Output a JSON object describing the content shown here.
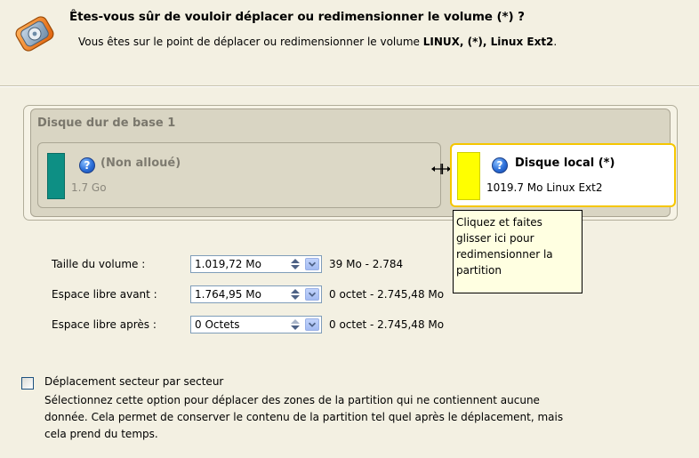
{
  "header": {
    "title": "Êtes-vous sûr de vouloir déplacer ou redimensionner le volume (*) ?",
    "subtitle_prefix": "Vous êtes sur le point de déplacer ou redimensionner le volume ",
    "subtitle_bold": "LINUX, (*), Linux Ext2",
    "subtitle_suffix": ".",
    "icon": "partition-resize-icon"
  },
  "disk": {
    "title": "Disque dur de base 1",
    "partitions": [
      {
        "name": "(Non alloué)",
        "detail": "1.7 Go",
        "color": "#0d8f84",
        "icon": "help-icon"
      },
      {
        "name": "Disque local (*)",
        "detail": "1019.7 Mo Linux Ext2",
        "color": "#ffff00",
        "icon": "help-icon"
      }
    ]
  },
  "tooltip": {
    "lines": [
      "Cliquez et faites",
      "glisser ici pour",
      "redimensionner la",
      "partition"
    ]
  },
  "fields": [
    {
      "label": "Taille du volume :",
      "value": "1.019,72 Mo",
      "range": "39 Mo - 2.784"
    },
    {
      "label": "Espace libre avant :",
      "value": "1.764,95 Mo",
      "range": "0 octet - 2.745,48 Mo"
    },
    {
      "label": "Espace libre après :",
      "value": "0 Octets",
      "range": "0 octet - 2.745,48 Mo"
    }
  ],
  "option": {
    "label": "Déplacement secteur par secteur",
    "checked": false,
    "description_lines": [
      "Sélectionnez cette option pour déplacer des zones de la partition qui ne contiennent aucune",
      "donnée. Cela permet de conserver le contenu de la partition tel quel après le déplacement, mais",
      "cela prend du temps."
    ]
  },
  "colors": {
    "background": "#f3f0e2",
    "selected_border": "#f5c600",
    "tooltip_bg": "#ffffe1"
  }
}
